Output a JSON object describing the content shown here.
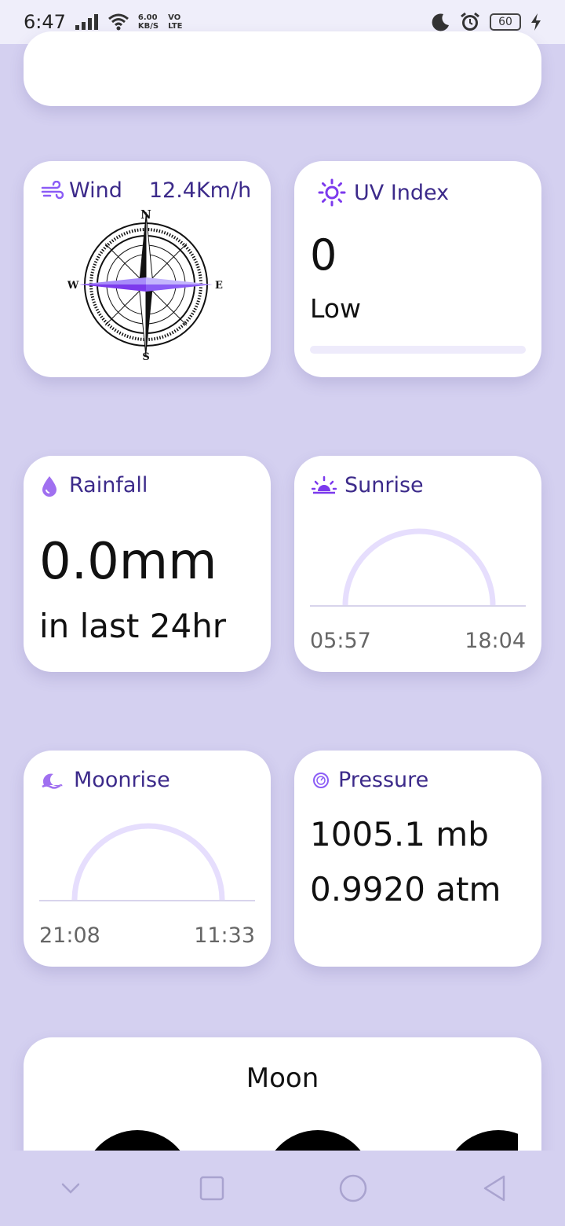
{
  "status_bar": {
    "time": "6:47",
    "net_speed_top": "6.00",
    "net_speed_bottom": "KB/S",
    "volte_top": "VO",
    "volte_bottom": "LTE",
    "battery": "60"
  },
  "wind": {
    "title": "Wind",
    "speed": "12.4Km/h",
    "compass": {
      "n": "N",
      "s": "S",
      "e": "E",
      "w": "W"
    }
  },
  "uv": {
    "title": "UV Index",
    "value": "0",
    "level": "Low",
    "progress": 0
  },
  "rainfall": {
    "title": "Rainfall",
    "amount": "0.0mm",
    "period": "in last 24hr"
  },
  "sunrise": {
    "title": "Sunrise",
    "rise": "05:57",
    "set": "18:04"
  },
  "moonrise": {
    "title": "Moonrise",
    "rise": "21:08",
    "set": "11:33"
  },
  "pressure": {
    "title": "Pressure",
    "mb": "1005.1 mb",
    "atm": "0.9920 atm"
  },
  "moon": {
    "title": "Moon"
  },
  "colors": {
    "accent": "#8b5cf6",
    "title_text": "#3c2a8a",
    "background": "#d4d0f0",
    "arc": "#e6defd"
  }
}
